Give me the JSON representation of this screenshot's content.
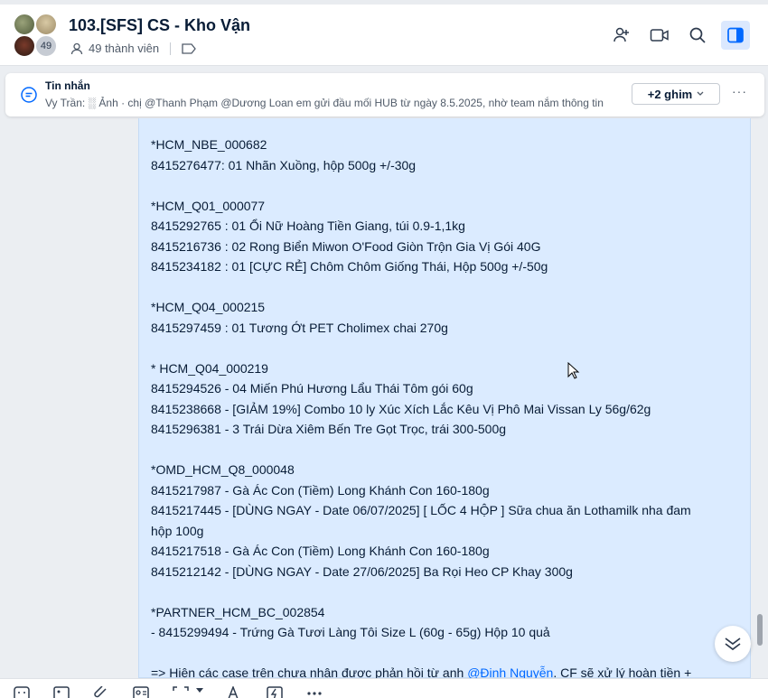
{
  "header": {
    "title": "103.[SFS] CS - Kho Vận",
    "member_count_badge": "49",
    "members_label": "49 thành viên"
  },
  "pinned": {
    "title": "Tin nhắn",
    "preview": "Vy Trần: ░ Ảnh · chị @Thanh Phạm @Dương Loan em gửi đầu mối HUB từ ngày 8.5.2025, nhờ team nắm thông tin",
    "pins_button": "+2 ghim",
    "more": "···"
  },
  "message": {
    "lines": [
      "*HCM_NBE_000682",
      "8415276477: 01 Nhãn Xuồng, hộp 500g +/-30g",
      "",
      "*HCM_Q01_000077",
      "8415292765 : 01 Ổi Nữ Hoàng Tiền Giang, túi 0.9-1,1kg",
      "8415216736 : 02 Rong Biển Miwon O'Food Giòn Trộn Gia Vị Gói 40G",
      "8415234182 : 01 [CỰC RẺ] Chôm Chôm Giống Thái, Hộp 500g +/-50g",
      "",
      "*HCM_Q04_000215",
      "8415297459 : 01 Tương Ớt PET Cholimex chai 270g",
      "",
      "* HCM_Q04_000219",
      "8415294526 - 04 Miến Phú Hương Lẩu Thái Tôm gói 60g",
      "8415238668 - [GIẢM 19%] Combo 10 ly Xúc Xích Lắc Kêu Vị Phô Mai Vissan Ly 56g/62g",
      "8415296381 - 3 Trái Dừa Xiêm Bến Tre Gọt Trọc, trái 300-500g",
      "",
      "*OMD_HCM_Q8_000048",
      "8415217987 - Gà Ác Con (Tiềm) Long Khánh Con 160-180g",
      "8415217445 - [DÙNG NGAY - Date 06/07/2025] [ LỐC 4 HỘP ] Sữa chua ăn Lothamilk nha đam",
      "hộp 100g",
      "8415217518 - Gà Ác Con (Tiềm) Long Khánh Con 160-180g",
      "8415212142 - [DÙNG NGAY - Date 27/06/2025] Ba Rọi Heo CP Khay 300g",
      "",
      "*PARTNER_HCM_BC_002854",
      "- 8415299494 - Trứng Gà Tươi Làng Tôi Size L (60g - 65g) Hộp 10 quả",
      ""
    ],
    "last_prefix": "=> Hiện các case trên chưa nhận được phản hồi từ anh ",
    "last_mention": "@Định Nguyễn",
    "last_suffix": ". CF sẽ xử lý hoàn tiền +"
  }
}
